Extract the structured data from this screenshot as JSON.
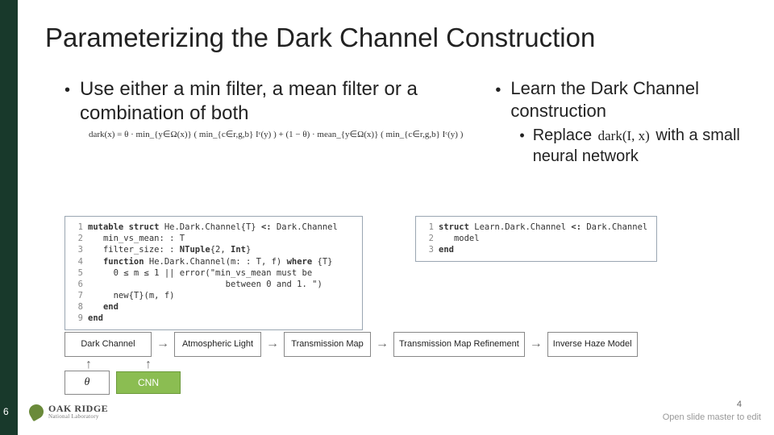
{
  "title": "Parameterizing the Dark Channel Construction",
  "left": {
    "bullet": "Use either a min filter, a mean filter or a combination of both",
    "formula": "dark(x) = θ · min_{y∈Ω(x)} ( min_{c∈r,g,b} Iᶜ(y) ) + (1 − θ) · mean_{y∈Ω(x)} ( min_{c∈r,g,b} Iᶜ(y) )"
  },
  "right": {
    "bullet": "Learn the Dark Channel construction",
    "sub_prefix": "Replace",
    "sub_math": "dark(I, x)",
    "sub_suffix": "with a small neural network"
  },
  "code_left": [
    "mutable struct He.Dark.Channel{T} <: Dark.Channel",
    "   min_vs_mean: : T",
    "   filter_size: : NTuple{2, Int}",
    "   function He.Dark.Channel(m: : T, f) where {T}",
    "     0 ≤ m ≤ 1 || error(\"min_vs_mean must be",
    "                           between 0 and 1. \")",
    "     new{T}(m, f)",
    "   end",
    "end"
  ],
  "code_right": [
    "struct Learn.Dark.Channel <: Dark.Channel",
    "   model",
    "end"
  ],
  "pipeline": [
    "Dark Channel",
    "Atmospheric Light",
    "Transmission Map",
    "Transmission Map Refinement",
    "Inverse Haze Model"
  ],
  "theta": "θ",
  "cnn": "CNN",
  "logo": {
    "line1": "OAK RIDGE",
    "line2": "National Laboratory"
  },
  "slidenum": "4",
  "editnote": "Open slide master to edit",
  "side_page": "6"
}
